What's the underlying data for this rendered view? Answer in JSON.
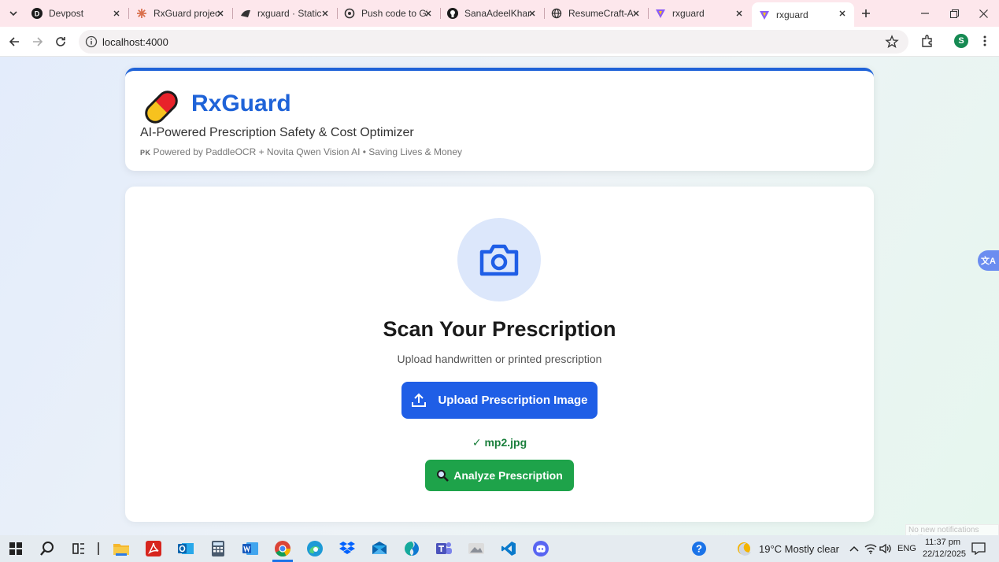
{
  "browser": {
    "tabs": [
      {
        "title": "Devpost",
        "icon": "devpost-icon"
      },
      {
        "title": "RxGuard project",
        "icon": "claude-icon"
      },
      {
        "title": "rxguard · Static S",
        "icon": "static-site-icon"
      },
      {
        "title": "Push code to Gi",
        "icon": "chatgpt-icon"
      },
      {
        "title": "SanaAdeelKhan/",
        "icon": "github-icon"
      },
      {
        "title": "ResumeCraft-AI",
        "icon": "globe-icon"
      },
      {
        "title": "rxguard",
        "icon": "vite-icon"
      },
      {
        "title": "rxguard",
        "icon": "vite-icon",
        "active": true
      }
    ],
    "url": "localhost:4000",
    "profile_initial": "S"
  },
  "header": {
    "brand": "RxGuard",
    "subtitle": "AI-Powered Prescription Safety & Cost Optimizer",
    "flag": "PK",
    "powered_by": "Powered by PaddleOCR + Novita Qwen Vision AI • Saving Lives & Money"
  },
  "scan": {
    "title": "Scan Your Prescription",
    "subtitle": "Upload handwritten or printed prescription",
    "upload_label": "Upload Prescription Image",
    "file_status": "✓ mp2.jpg",
    "analyze_label": "Analyze Prescription"
  },
  "overlay": {
    "notification_text": "No new notifications (Off)"
  },
  "taskbar": {
    "weather": "19°C  Mostly clear",
    "language": "ENG",
    "time": "11:37 pm",
    "date": "22/12/2025"
  },
  "colors": {
    "brand_blue": "#1f63d8",
    "upload_blue": "#1f5ee6",
    "analyze_green": "#1ea34a",
    "success_green": "#1a7f3c"
  }
}
